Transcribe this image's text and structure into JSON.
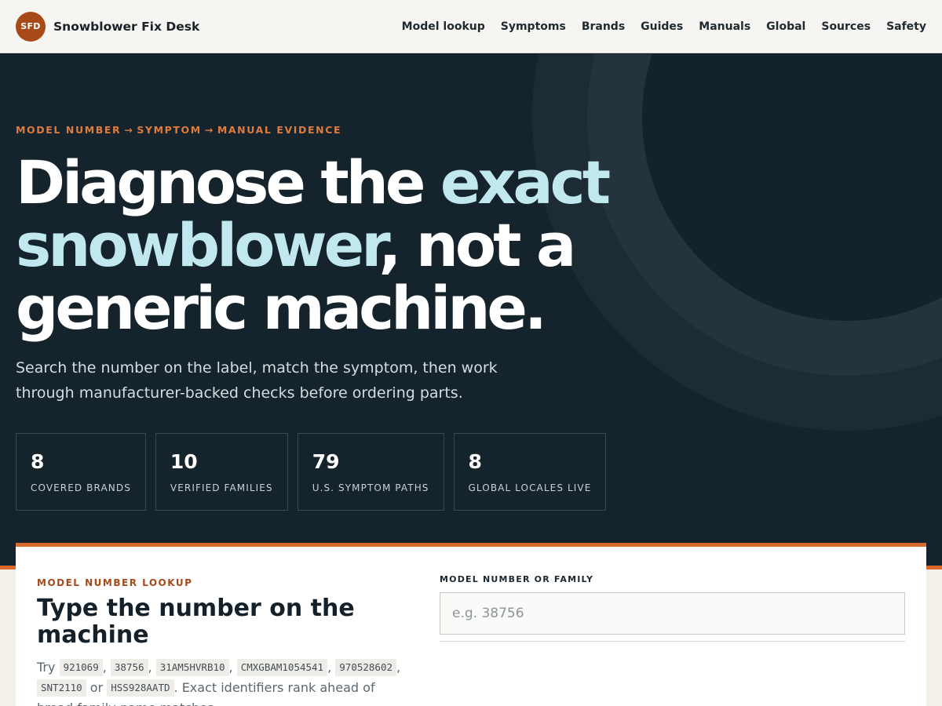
{
  "header": {
    "logo_initials": "SFD",
    "brand": "Snowblower Fix Desk",
    "nav": [
      "Model lookup",
      "Symptoms",
      "Brands",
      "Guides",
      "Manuals",
      "Global",
      "Sources",
      "Safety"
    ]
  },
  "hero": {
    "eyebrow": {
      "step1": "MODEL NUMBER",
      "step2": "SYMPTOM",
      "step3": "MANUAL EVIDENCE",
      "arrow": "→"
    },
    "headline": {
      "part1": "Diagnose the ",
      "highlight": "exact snowblower",
      "part2": ", not a generic machine."
    },
    "lede": "Search the number on the label, match the symptom, then work through manufacturer-backed checks before ordering parts.",
    "stats": [
      {
        "value": "8",
        "label": "COVERED BRANDS"
      },
      {
        "value": "10",
        "label": "VERIFIED FAMILIES"
      },
      {
        "value": "79",
        "label": "U.S. SYMPTOM PATHS"
      },
      {
        "value": "8",
        "label": "GLOBAL LOCALES LIVE"
      }
    ]
  },
  "lookup": {
    "eyebrow": "MODEL NUMBER LOOKUP",
    "title": "Type the number on the machine",
    "try_word": "Try",
    "examples": [
      "921069",
      "38756",
      "31AM5HVRB10",
      "CMXGBAM1054541",
      "970528602",
      "SNT2110",
      "HSS928AATD"
    ],
    "separator": ",",
    "or_word": "or",
    "note": ". Exact identifiers rank ahead of broad family-name matches.",
    "field_label": "MODEL NUMBER OR FAMILY",
    "placeholder": "e.g. 38756",
    "value": ""
  },
  "colors": {
    "accent": "#d96a2b",
    "brand_badge": "#a8491a",
    "hero_bg": "#15232c",
    "highlight_text": "#c1e8ee"
  }
}
